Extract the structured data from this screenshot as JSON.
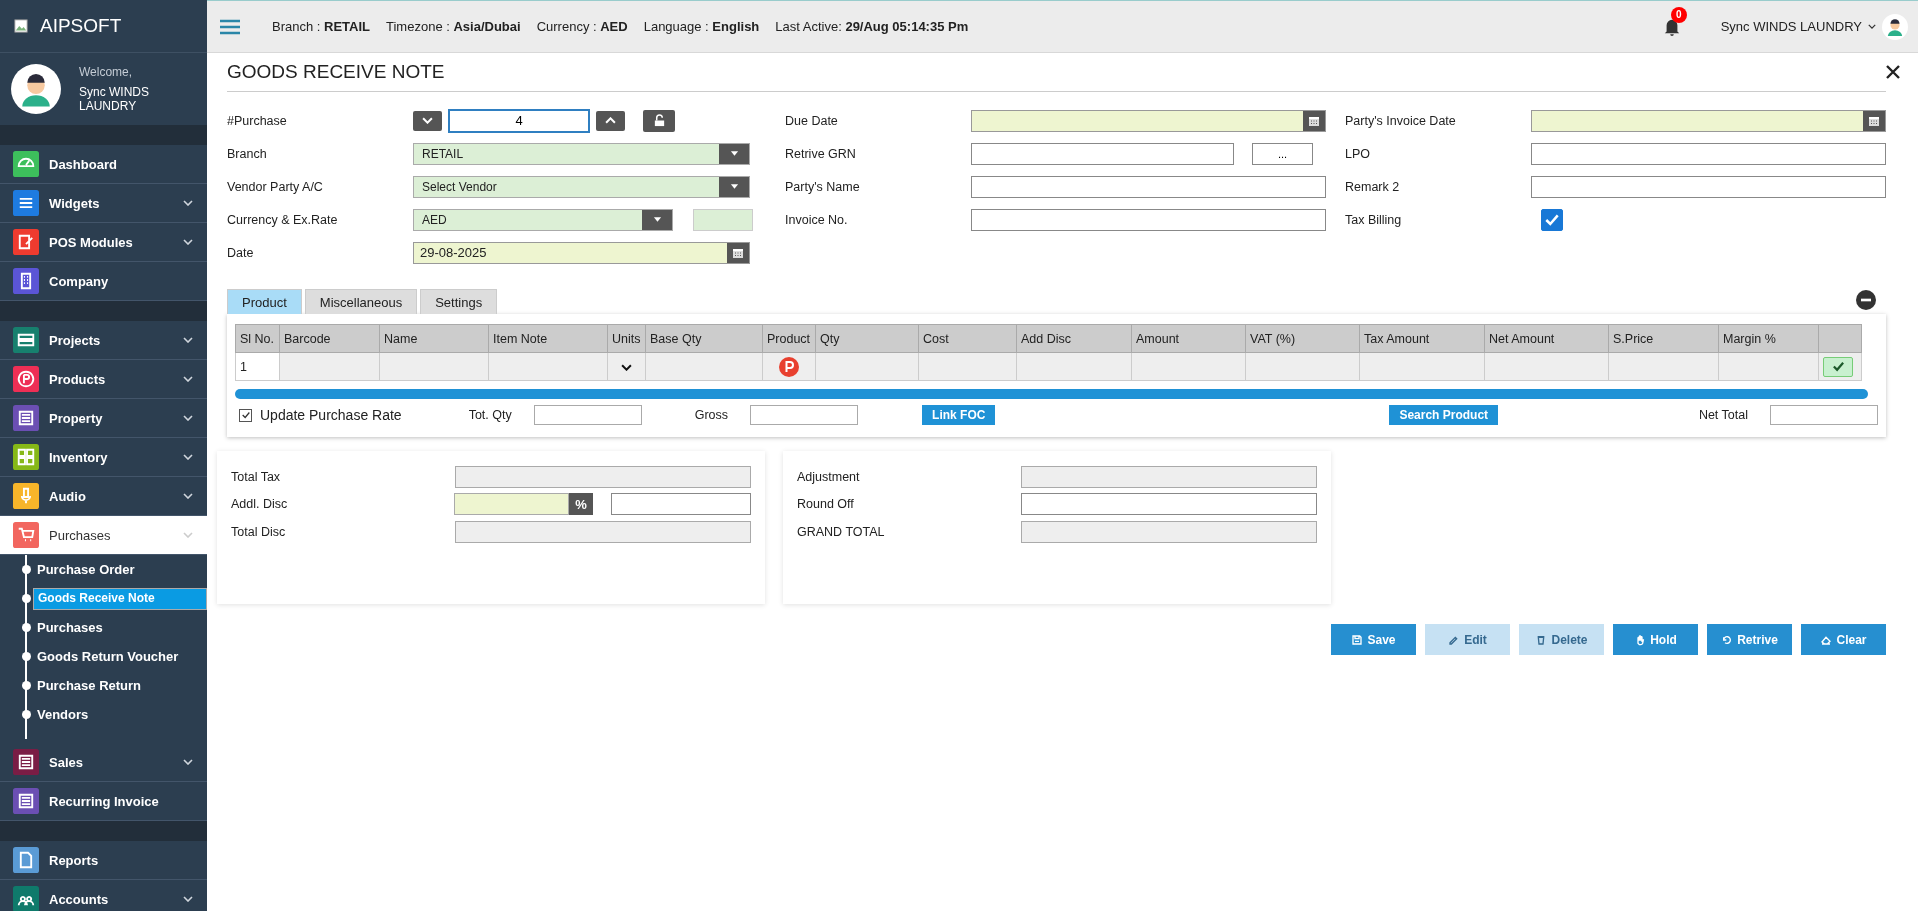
{
  "brand": {
    "name": "AIPSOFT"
  },
  "user": {
    "welcome": "Welcome,",
    "name": "Sync WINDS LAUNDRY"
  },
  "sidebar": {
    "groups": [
      {
        "items": [
          {
            "label": "Dashboard",
            "color": "#3dbf5c",
            "expandable": false,
            "active": false
          },
          {
            "label": "Widgets",
            "color": "#1e7be0",
            "expandable": true,
            "active": false
          },
          {
            "label": "POS Modules",
            "color": "#ee3b2f",
            "expandable": true,
            "active": false
          },
          {
            "label": "Company",
            "color": "#5b55d6",
            "expandable": false,
            "active": false
          }
        ]
      },
      {
        "items": [
          {
            "label": "Projects",
            "color": "#17806e",
            "expandable": true,
            "active": false
          },
          {
            "label": "Products",
            "color": "#ee2f55",
            "expandable": true,
            "active": false
          },
          {
            "label": "Property",
            "color": "#6b4fb3",
            "expandable": true,
            "active": false
          },
          {
            "label": "Inventory",
            "color": "#86b817",
            "expandable": true,
            "active": false
          },
          {
            "label": "Audio",
            "color": "#f7b52a",
            "expandable": true,
            "active": false
          },
          {
            "label": "Purchases",
            "color": "#f2665f",
            "expandable": true,
            "active": true,
            "children": [
              {
                "label": "Purchase Order",
                "selected": false
              },
              {
                "label": "Goods Receive Note",
                "selected": true
              },
              {
                "label": "Purchases",
                "selected": false
              },
              {
                "label": "Goods Return Voucher",
                "selected": false
              },
              {
                "label": "Purchase Return",
                "selected": false
              },
              {
                "label": "Vendors",
                "selected": false
              }
            ]
          },
          {
            "label": "Sales",
            "color": "#7a1d45",
            "expandable": true,
            "active": false
          },
          {
            "label": "Recurring Invoice",
            "color": "#6b4fb3",
            "expandable": false,
            "active": false
          }
        ]
      },
      {
        "items": [
          {
            "label": "Reports",
            "color": "#5a9bd5",
            "expandable": false,
            "active": false
          },
          {
            "label": "Accounts",
            "color": "#0f7a6b",
            "expandable": true,
            "active": false
          }
        ]
      }
    ]
  },
  "topbar": {
    "fields": [
      {
        "label": "Branch :",
        "value": "RETAIL"
      },
      {
        "label": "Timezone :",
        "value": "Asia/Dubai"
      },
      {
        "label": "Currency :",
        "value": "AED"
      },
      {
        "label": "Language :",
        "value": "English"
      },
      {
        "label": "Last Active:",
        "value": "29/Aug 05:14:35 Pm"
      }
    ],
    "notifications": "0",
    "user": "Sync WINDS LAUNDRY"
  },
  "form": {
    "title": "GOODS RECEIVE NOTE",
    "columns": [
      [
        {
          "label": "#Purchase",
          "kind": "stepper",
          "value": "4"
        },
        {
          "label": "Branch",
          "kind": "select",
          "value": "RETAIL"
        },
        {
          "label": "Vendor Party A/C",
          "kind": "select",
          "value": "Select Vendor"
        },
        {
          "label": "Currency & Ex.Rate",
          "kind": "select-rate",
          "value": "AED"
        },
        {
          "label": "Date",
          "kind": "date",
          "value": "29-08-2025"
        }
      ],
      [
        {
          "label": "Due Date",
          "kind": "date"
        },
        {
          "label": "Retrive GRN",
          "kind": "lookup",
          "button": "..."
        },
        {
          "label": "Party's Name",
          "kind": "text"
        },
        {
          "label": "Invoice No.",
          "kind": "text"
        }
      ],
      [
        {
          "label": "Party's Invoice Date",
          "kind": "date"
        },
        {
          "label": "LPO",
          "kind": "text"
        },
        {
          "label": "Remark 2",
          "kind": "text"
        },
        {
          "label": "Tax Billing",
          "kind": "checkbox",
          "checked": true
        }
      ]
    ]
  },
  "tabs": [
    {
      "label": "Product",
      "selected": true
    },
    {
      "label": "Miscellaneous",
      "selected": false
    },
    {
      "label": "Settings",
      "selected": false
    }
  ],
  "table": {
    "columns": [
      {
        "label": "Sl No.",
        "kind": "serial"
      },
      {
        "label": "Barcode",
        "kind": "text"
      },
      {
        "label": "Name",
        "kind": "text"
      },
      {
        "label": "Item Note",
        "kind": "text"
      },
      {
        "label": "Units",
        "kind": "select"
      },
      {
        "label": "Base Qty",
        "kind": "text"
      },
      {
        "label": "Product",
        "kind": "product"
      },
      {
        "label": "Qty",
        "kind": "text"
      },
      {
        "label": "Cost",
        "kind": "text"
      },
      {
        "label": "Add Disc",
        "kind": "text"
      },
      {
        "label": "Amount",
        "kind": "text"
      },
      {
        "label": "VAT (%)",
        "kind": "text"
      },
      {
        "label": "Tax Amount",
        "kind": "text"
      },
      {
        "label": "Net Amount",
        "kind": "text"
      },
      {
        "label": "S.Price",
        "kind": "text"
      },
      {
        "label": "Margin %",
        "kind": "text"
      },
      {
        "kind": "confirm"
      }
    ],
    "rows": [
      {
        "sl_no": "1"
      }
    ]
  },
  "table_footer": {
    "update_rate": {
      "label": "Update Purchase Rate",
      "checked": true
    },
    "tot_qty": "Tot. Qty",
    "gross": "Gross",
    "link_foc": "Link FOC",
    "search_product": "Search Product",
    "net_total": "Net Total"
  },
  "totals": [
    [
      {
        "label": "Total Tax",
        "kind": "readonly"
      },
      {
        "label": "Addl. Disc",
        "kind": "percent",
        "button": "%"
      },
      {
        "label": "Total Disc",
        "kind": "readonly"
      }
    ],
    [
      {
        "label": "Adjustment",
        "kind": "readonly"
      },
      {
        "label": "Round Off",
        "kind": "input"
      },
      {
        "label": "GRAND TOTAL",
        "kind": "readonly"
      }
    ]
  ],
  "actions": [
    {
      "label": "Save",
      "disabled": false
    },
    {
      "label": "Edit",
      "disabled": true
    },
    {
      "label": "Delete",
      "disabled": true
    },
    {
      "label": "Hold",
      "disabled": false
    },
    {
      "label": "Retrive",
      "disabled": false
    },
    {
      "label": "Clear",
      "disabled": false
    }
  ]
}
